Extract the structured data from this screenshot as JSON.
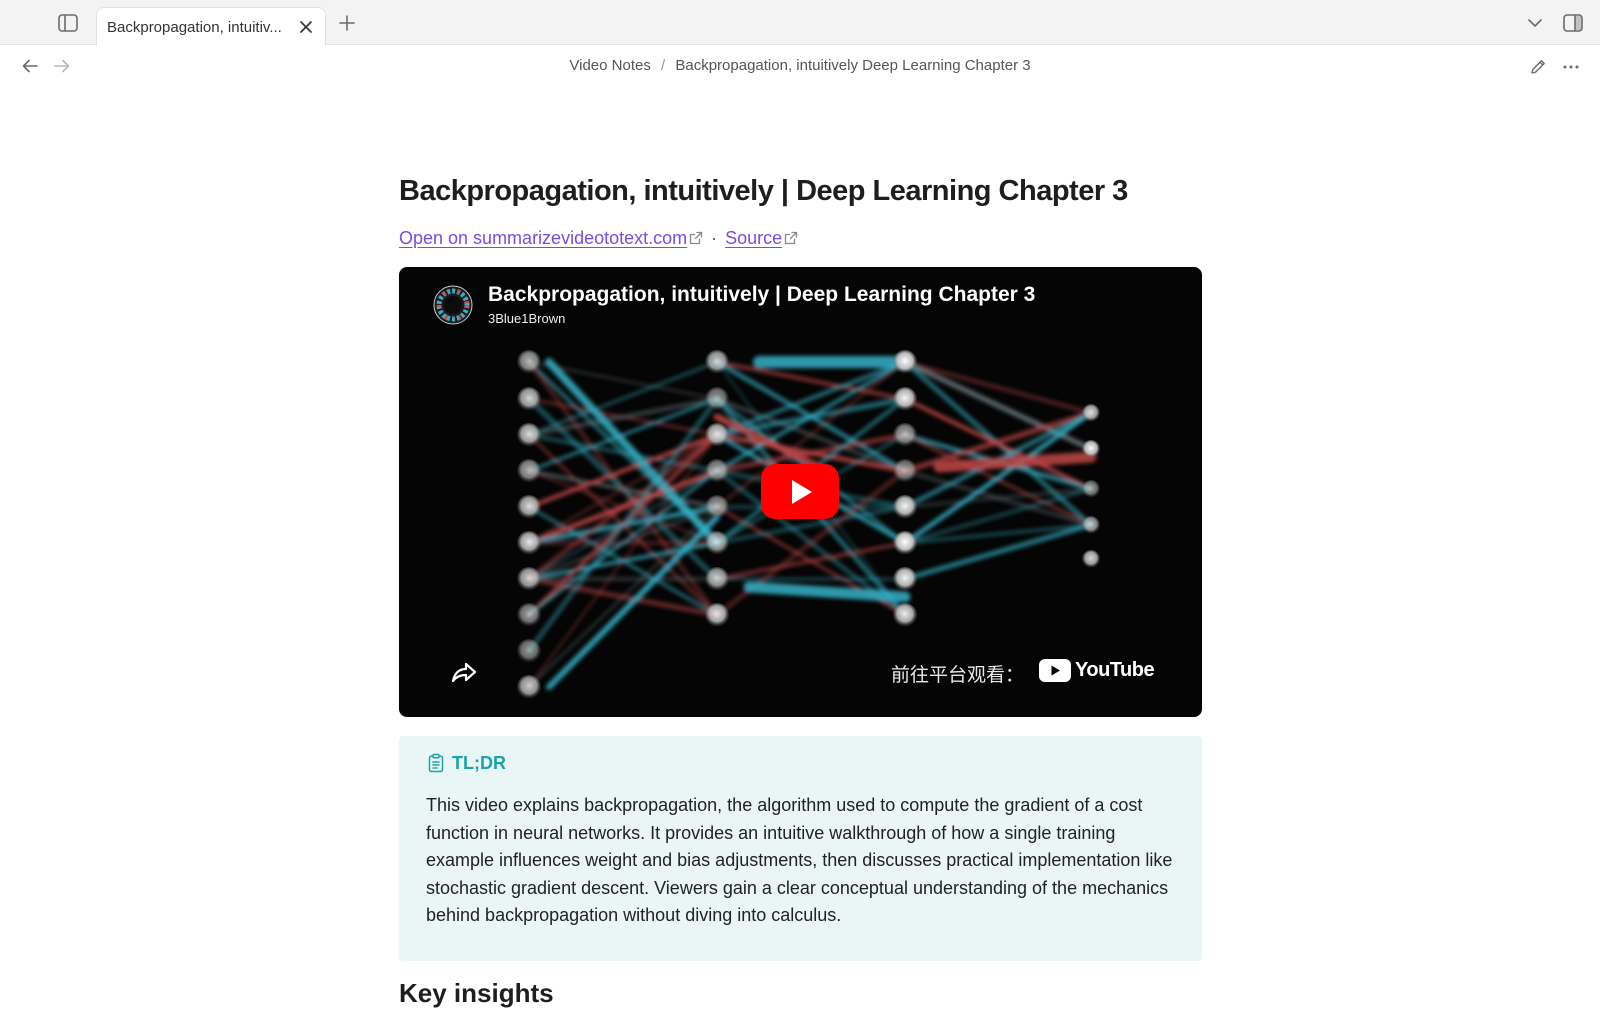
{
  "tabbar": {
    "tab_title": "Backpropagation, intuitiv..."
  },
  "breadcrumb": {
    "folder": "Video Notes",
    "separator": "/",
    "page": "Backpropagation, intuitively Deep Learning Chapter 3"
  },
  "page": {
    "title": "Backpropagation, intuitively | Deep Learning Chapter 3",
    "links": {
      "open_label": "Open on summarizevideototext.com",
      "separator": "·",
      "source_label": "Source"
    },
    "link_color": "#7a4be0"
  },
  "video": {
    "title": "Backpropagation, intuitively | Deep Learning Chapter 3",
    "channel": "3Blue1Brown",
    "watch_on_label": "前往平台观看：",
    "platform": "YouTube",
    "play_color": "#ff0000"
  },
  "callout": {
    "heading": "TL;DR",
    "accent": "#1aa3a8",
    "background": "#eaf6f6",
    "body": "This video explains backpropagation, the algorithm used to compute the gradient of a cost function in neural networks. It provides an intuitive walkthrough of how a single training example influences weight and bias adjustments, then discusses practical implementation like stochastic gradient descent. Viewers gain a clear conceptual understanding of the mechanics behind backpropagation without diving into calculus."
  },
  "next_section": {
    "heading": "Key insights"
  },
  "icons": [
    "sidebar-toggle-icon",
    "close-icon",
    "plus-icon",
    "chevron-down-icon",
    "right-sidebar-icon",
    "arrow-left-icon",
    "arrow-right-icon",
    "external-link-icon",
    "share-icon",
    "clipboard-icon",
    "pencil-icon",
    "more-icon",
    "youtube-icon"
  ]
}
